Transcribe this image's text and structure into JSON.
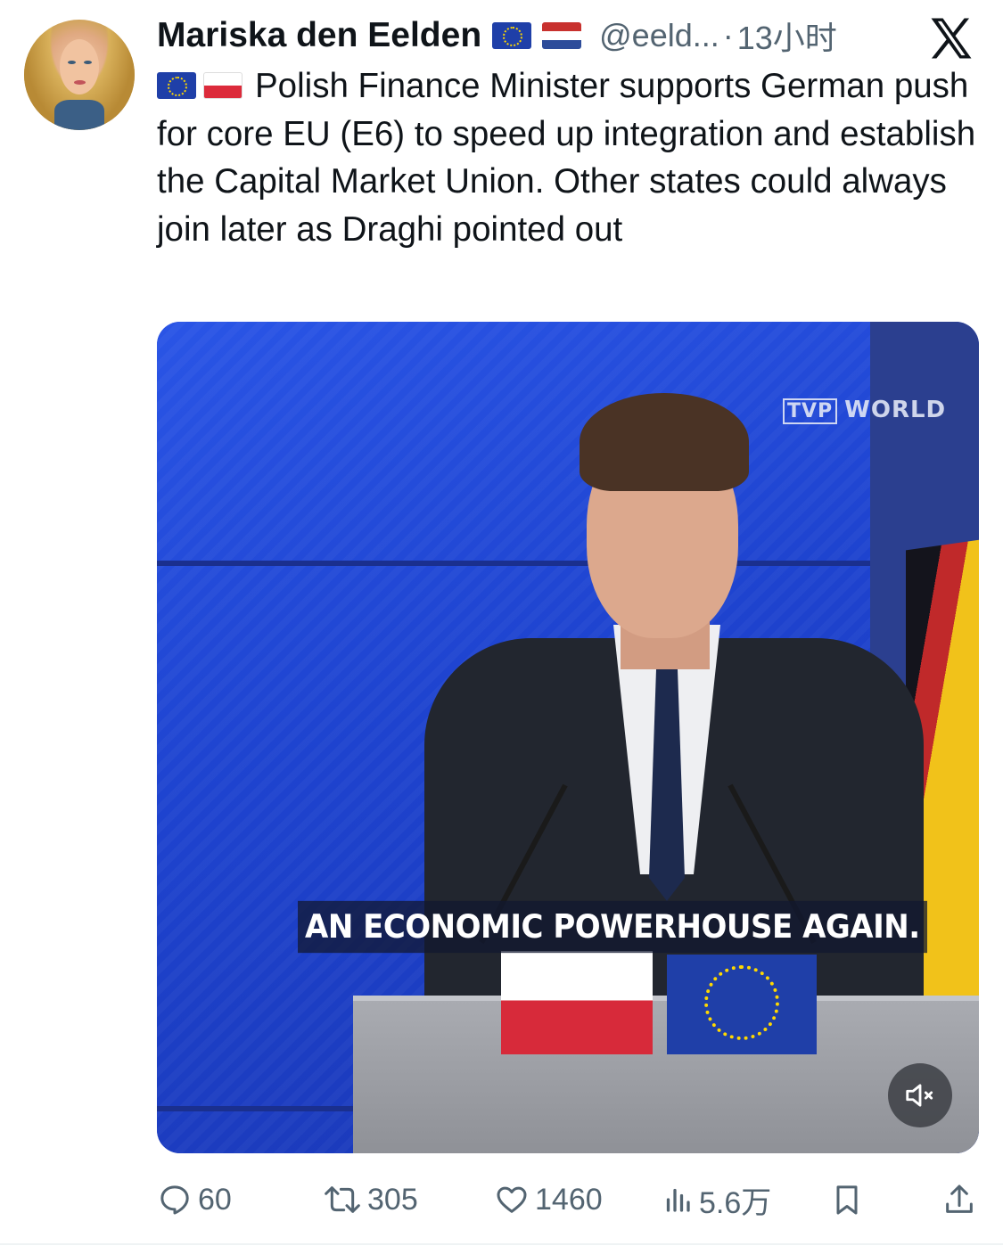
{
  "author": {
    "name": "Mariska den Eelden",
    "handle": "@eeld...",
    "separator": "·",
    "time": "13小时"
  },
  "tweet": {
    "text": "Polish Finance Minister supports German push for core EU (E6) to speed up integration and establish the Capital Market Union. Other states could always join later as Draghi pointed out"
  },
  "media": {
    "subtitle": "AN ECONOMIC POWERHOUSE AGAIN.",
    "channel_mark": "TVP",
    "channel_name": "WORLD"
  },
  "actions": {
    "replies": "60",
    "reposts": "305",
    "likes": "1460",
    "views": "5.6万"
  },
  "colors": {
    "secondary_text": "#536471",
    "primary_text": "#0f1419"
  }
}
